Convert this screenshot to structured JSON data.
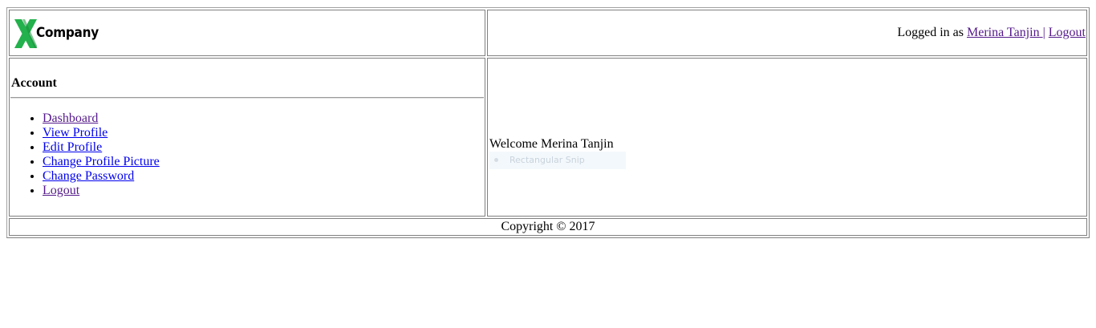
{
  "header": {
    "logo_text": "Company",
    "logged_in_prefix": "Logged in as",
    "user_name": "Merina Tanjin",
    "separator": "|",
    "logout_label": "Logout"
  },
  "sidebar": {
    "title": "Account",
    "items": [
      {
        "label": "Dashboard"
      },
      {
        "label": "View Profile"
      },
      {
        "label": "Edit Profile"
      },
      {
        "label": "Change Profile Picture"
      },
      {
        "label": "Change Password"
      },
      {
        "label": "Logout"
      }
    ]
  },
  "main": {
    "welcome_text": "Welcome Merina Tanjin",
    "snip_label": "Rectangular Snip"
  },
  "footer": {
    "copyright": "Copyright © 2017"
  },
  "colors": {
    "link": "#0000ee",
    "visited_link": "#551a8b",
    "logo_green": "#22b14c",
    "border": "#808080"
  }
}
